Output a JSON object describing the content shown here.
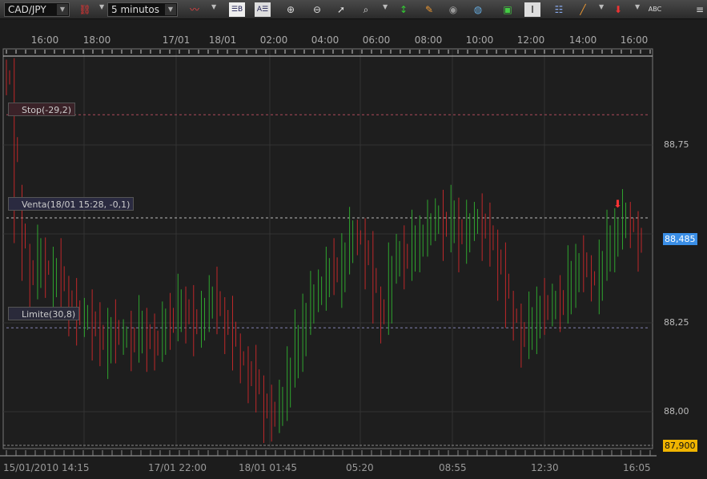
{
  "toolbar": {
    "symbol": "CAD/JPY",
    "timeframe": "5 minutos",
    "icons": [
      "link-icon",
      "chart-type-icon",
      "layout-b-icon",
      "layout-a-icon",
      "zoom-in-icon",
      "zoom-out-icon",
      "cursor-icon",
      "vertical-zoom-icon",
      "fit-icon",
      "edit-icon",
      "eye-icon",
      "globe-icon",
      "image-icon",
      "text-cursor-icon",
      "list-icon",
      "pencil-icon",
      "indicator-icon",
      "abc-icon",
      "menu-icon"
    ]
  },
  "top_axis": [
    "16:00",
    "18:00",
    "17/01",
    "18/01",
    "02:00",
    "04:00",
    "06:00",
    "08:00",
    "10:00",
    "12:00",
    "14:00",
    "16:00"
  ],
  "bottom_axis": [
    "15/01/2010 14:15",
    "17/01 22:00",
    "18/01 01:45",
    "05:20",
    "08:55",
    "12:30",
    "16:05"
  ],
  "price_axis": [
    "88,75",
    "88,25",
    "88,00"
  ],
  "current_price": "88,485",
  "low_price": "87,900",
  "orders": {
    "stop": "Stop(-29,2)",
    "venta": "Venta(18/01 15:28, -0,1)",
    "limite": "Limite(30,8)"
  },
  "colors": {
    "up": "#2fa52f",
    "down": "#c0282a",
    "current": "#3a8ee6",
    "low": "#f0b400"
  },
  "chart_data": {
    "type": "candlestick",
    "ylim": [
      87.9,
      88.98
    ],
    "levels": {
      "stop": 88.835,
      "venta": 88.545,
      "limite": 88.236
    },
    "closes": [
      88.93,
      88.55,
      88.42,
      88.38,
      88.45,
      88.36,
      88.4,
      88.33,
      88.3,
      88.25,
      88.28,
      88.22,
      88.18,
      88.24,
      88.2,
      88.22,
      88.19,
      88.24,
      88.2,
      88.18,
      88.27,
      88.25,
      88.3,
      88.28,
      88.22,
      88.3,
      88.32,
      88.27,
      88.25,
      88.18,
      88.12,
      88.1,
      88.05,
      88.0,
      87.98,
      88.05,
      88.12,
      88.2,
      88.28,
      88.32,
      88.36,
      88.4,
      88.38,
      88.45,
      88.5,
      88.48,
      88.42,
      88.3,
      88.28,
      88.4,
      88.46,
      88.42,
      88.48,
      88.5,
      88.52,
      88.56,
      88.5,
      88.55,
      88.48,
      88.52,
      88.55,
      88.5,
      88.46,
      88.4,
      88.3,
      88.24,
      88.2,
      88.25,
      88.3,
      88.28,
      88.32,
      88.3,
      88.38,
      88.42,
      88.4,
      88.35,
      88.42,
      88.48,
      88.52,
      88.55,
      88.5,
      88.47
    ]
  }
}
